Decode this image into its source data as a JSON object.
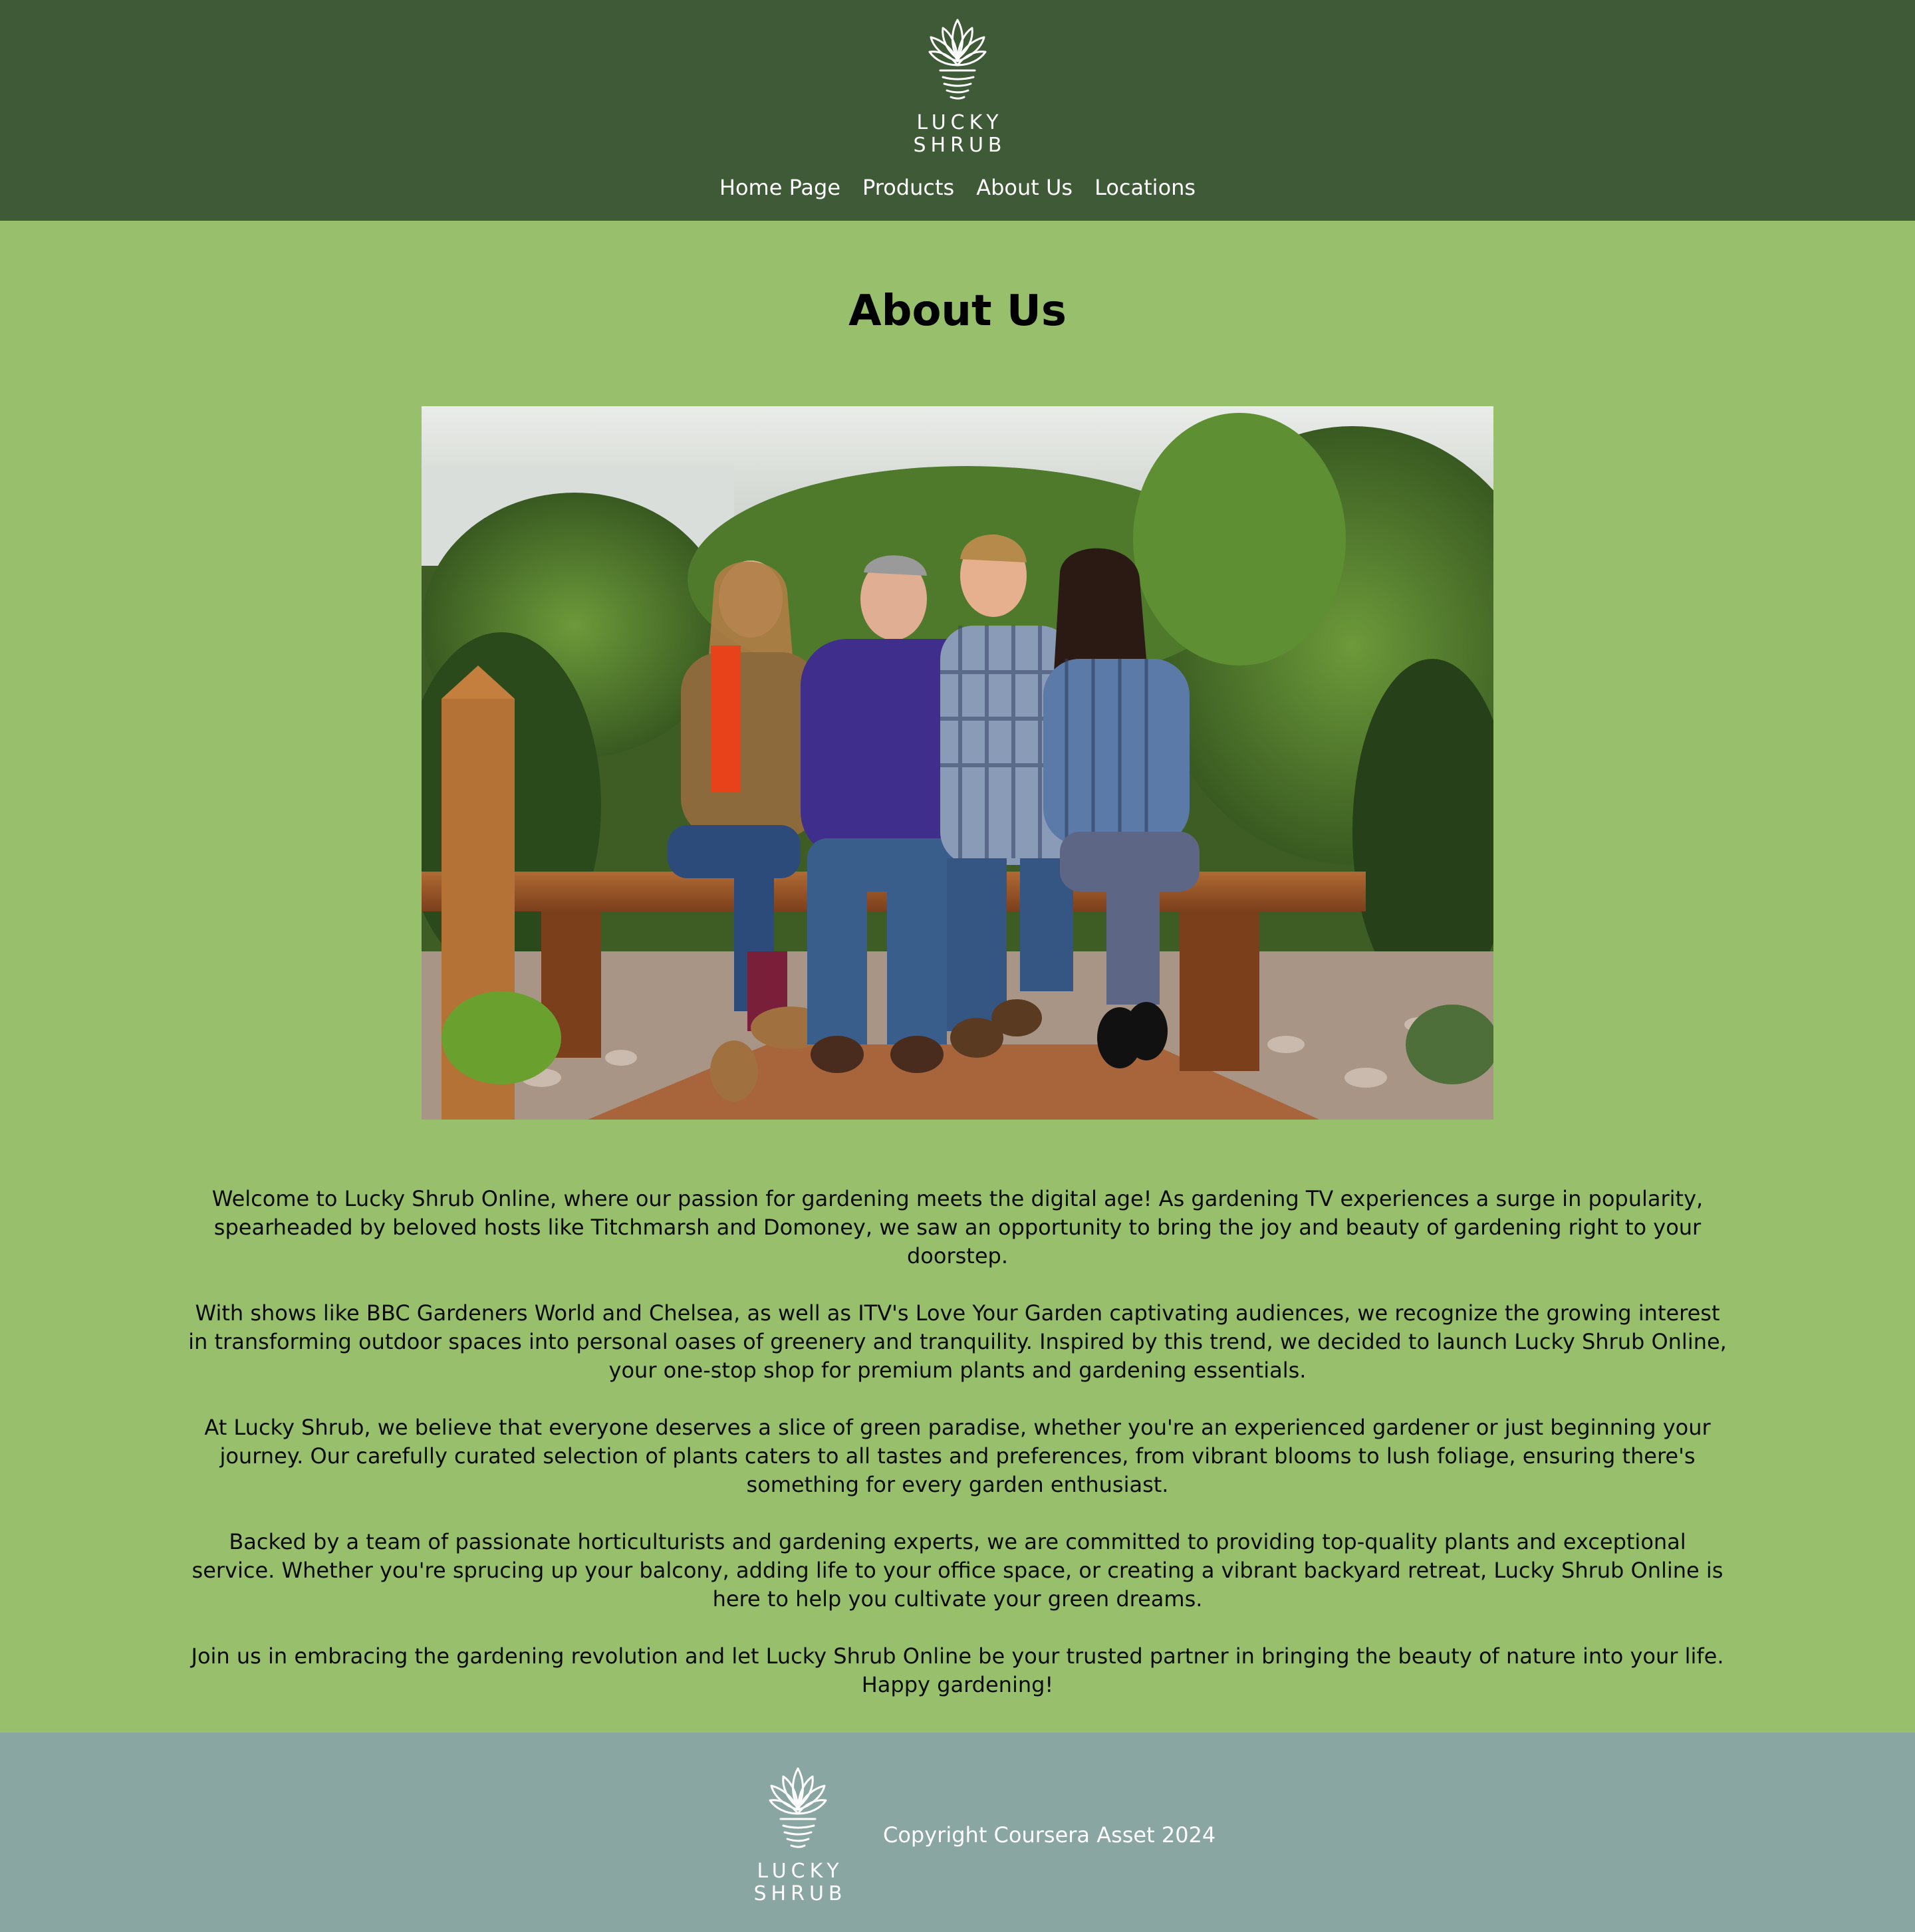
{
  "colors": {
    "header_bg": "#3f5a36",
    "page_bg": "#97bf6c",
    "footer_bg": "#8aa6a2",
    "text_light": "#ffffff",
    "text_dark": "#000000"
  },
  "brand": {
    "logo_icon": "succulent-plant-icon",
    "logo_line1": "LUCKY",
    "logo_line2": "SHRUB"
  },
  "nav": {
    "items": [
      {
        "label": "Home Page"
      },
      {
        "label": "Products"
      },
      {
        "label": "About Us"
      },
      {
        "label": "Locations"
      }
    ]
  },
  "main": {
    "title": "About Us",
    "photo_alt": "Four gardeners seated on a wooden bench in a garden",
    "paragraphs": [
      "Welcome to Lucky Shrub Online, where our passion for gardening meets the digital age! As gardening TV experiences a surge in popularity, spearheaded by beloved hosts like Titchmarsh and Domoney, we saw an opportunity to bring the joy and beauty of gardening right to your doorstep.",
      "With shows like BBC Gardeners World and Chelsea, as well as ITV's Love Your Garden captivating audiences, we recognize the growing interest in transforming outdoor spaces into personal oases of greenery and tranquility. Inspired by this trend, we decided to launch Lucky Shrub Online, your one-stop shop for premium plants and gardening essentials.",
      "At Lucky Shrub, we believe that everyone deserves a slice of green paradise, whether you're an experienced gardener or just beginning your journey. Our carefully curated selection of plants caters to all tastes and preferences, from vibrant blooms to lush foliage, ensuring there's something for every garden enthusiast.",
      "Backed by a team of passionate horticulturists and gardening experts, we are committed to providing top-quality plants and exceptional service. Whether you're sprucing up your balcony, adding life to your office space, or creating a vibrant backyard retreat, Lucky Shrub Online is here to help you cultivate your green dreams.",
      "Join us in embracing the gardening revolution and let Lucky Shrub Online be your trusted partner in bringing the beauty of nature into your life. Happy gardening!"
    ]
  },
  "footer": {
    "copyright": "Copyright Coursera Asset 2024"
  }
}
